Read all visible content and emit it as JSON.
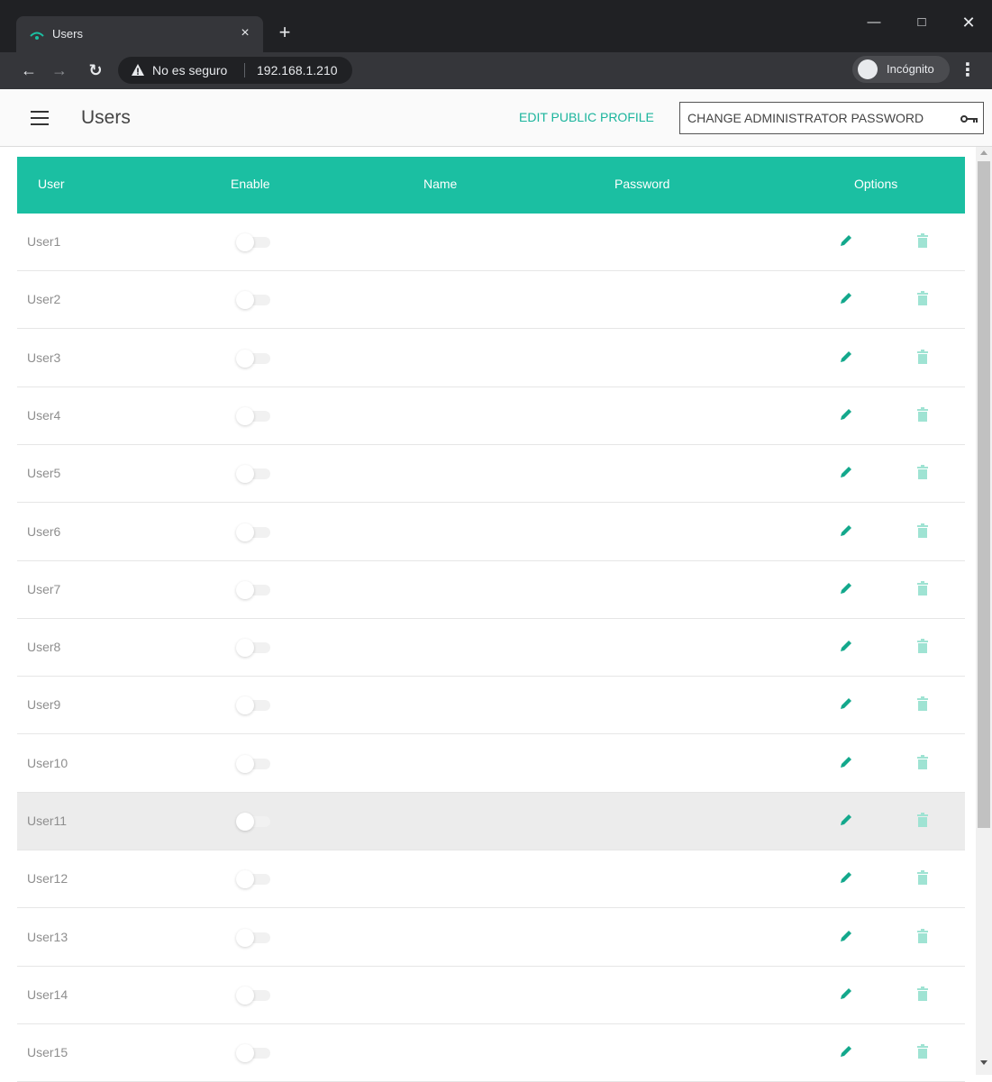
{
  "browser": {
    "tab_title": "Users",
    "tab_close": "×",
    "new_tab": "+",
    "security_text": "No es seguro",
    "url": "192.168.1.210",
    "incognito_label": "Incógnito",
    "menu": "⋮"
  },
  "header": {
    "title": "Users",
    "edit_public_profile": "EDIT PUBLIC PROFILE",
    "change_admin_password": "CHANGE ADMINISTRATOR PASSWORD"
  },
  "table": {
    "columns": [
      "User",
      "Enable",
      "Name",
      "Password",
      "Options"
    ],
    "rows": [
      {
        "user": "User1",
        "enabled": false,
        "name": "",
        "password": ""
      },
      {
        "user": "User2",
        "enabled": false,
        "name": "",
        "password": ""
      },
      {
        "user": "User3",
        "enabled": false,
        "name": "",
        "password": ""
      },
      {
        "user": "User4",
        "enabled": false,
        "name": "",
        "password": ""
      },
      {
        "user": "User5",
        "enabled": false,
        "name": "",
        "password": ""
      },
      {
        "user": "User6",
        "enabled": false,
        "name": "",
        "password": ""
      },
      {
        "user": "User7",
        "enabled": false,
        "name": "",
        "password": ""
      },
      {
        "user": "User8",
        "enabled": false,
        "name": "",
        "password": ""
      },
      {
        "user": "User9",
        "enabled": false,
        "name": "",
        "password": ""
      },
      {
        "user": "User10",
        "enabled": false,
        "name": "",
        "password": ""
      },
      {
        "user": "User11",
        "enabled": false,
        "name": "",
        "password": "",
        "highlighted": true
      },
      {
        "user": "User12",
        "enabled": false,
        "name": "",
        "password": ""
      },
      {
        "user": "User13",
        "enabled": false,
        "name": "",
        "password": ""
      },
      {
        "user": "User14",
        "enabled": false,
        "name": "",
        "password": ""
      },
      {
        "user": "User15",
        "enabled": false,
        "name": "",
        "password": ""
      }
    ]
  },
  "colors": {
    "accent": "#1bbfa2",
    "edit_icon": "#13a88c",
    "trash_icon": "#9fe3d3"
  }
}
